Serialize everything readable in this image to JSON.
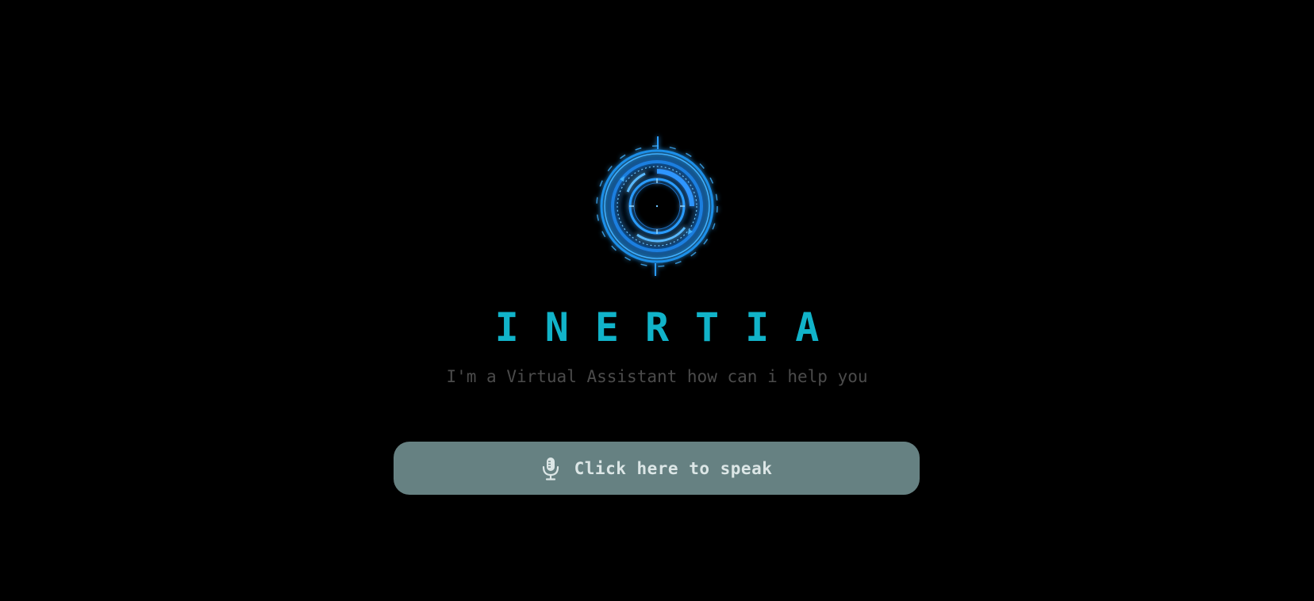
{
  "app": {
    "title": "INERTIA",
    "subtitle": "I'm a Virtual Assistant how can i help you"
  },
  "logo": {
    "icon": "hud-ring-logo",
    "color": "#1e8fe8",
    "glow_color": "#2aa8ff"
  },
  "speak_button": {
    "label": "Click here to speak",
    "icon": "microphone-icon",
    "background": "#668182",
    "text_color": "#dce6e6"
  },
  "colors": {
    "background": "#000000",
    "title": "#11b3c9",
    "subtitle": "#4b4b4b"
  }
}
